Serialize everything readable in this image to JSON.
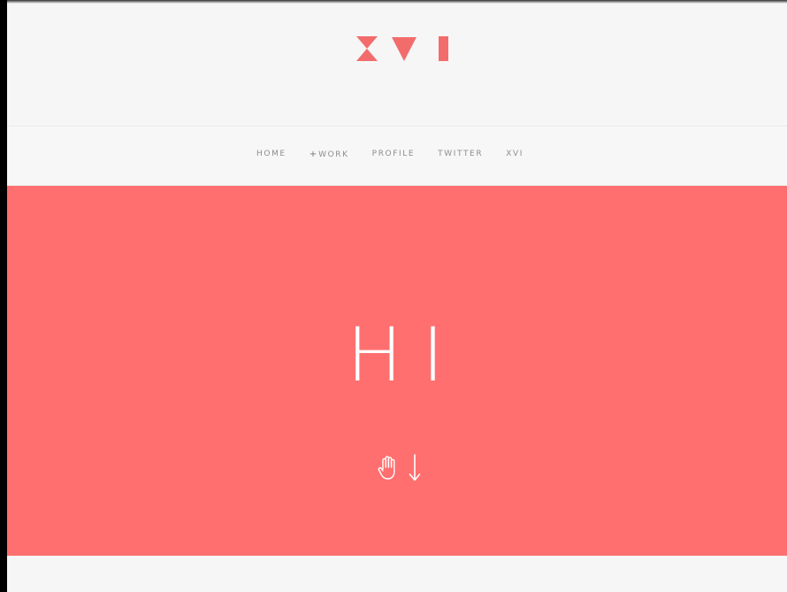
{
  "brand": {
    "logo_text": "XVI",
    "accent_color": "#ff6f6f",
    "logo_color": "#f36c6c"
  },
  "nav": {
    "items": [
      {
        "label": "HOME"
      },
      {
        "label": "WORK",
        "prefix": "+"
      },
      {
        "label": "PROFILE"
      },
      {
        "label": "TWITTER"
      },
      {
        "label": "XVI"
      }
    ]
  },
  "hero": {
    "title": "HI",
    "background": "#ff6f6f",
    "icons": [
      "hand-icon",
      "arrow-down-icon"
    ]
  },
  "colors": {
    "page_background": "#f6f6f6",
    "nav_text": "#8d8d8d",
    "hero_text": "#ffffff"
  }
}
